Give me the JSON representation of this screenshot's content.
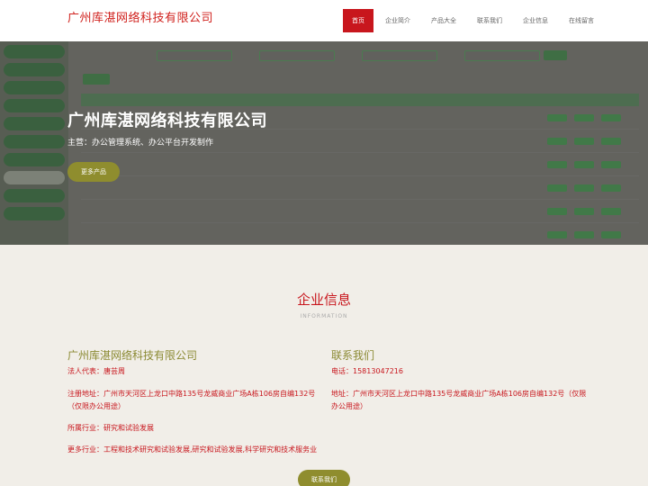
{
  "header": {
    "brand": "广州库湛网络科技有限公司",
    "nav": [
      "首页",
      "企业简介",
      "产品大全",
      "联系我们",
      "企业信息",
      "在线留言"
    ]
  },
  "hero": {
    "title": "广州库湛网络科技有限公司",
    "subtitle": "主营：办公管理系统、办公平台开发制作",
    "button": "更多产品"
  },
  "section": {
    "title": "企业信息",
    "subtitle": "INFORMATION"
  },
  "company": {
    "name": "广州库湛网络科技有限公司",
    "rep_label": "法人代表：",
    "rep_value": "唐芸周",
    "addr_label": "注册地址：",
    "addr_value": "广州市天河区上龙口中路135号龙威商业广场A栋106房自编132号（仅限办公用途）",
    "industry_label": "所属行业：",
    "industry_value": "研究和试验发展",
    "more_label": "更多行业：",
    "more_value": "工程和技术研究和试验发展,研究和试验发展,科学研究和技术服务业"
  },
  "contact": {
    "title": "联系我们",
    "phone_label": "电话：",
    "phone_value": "15813047216",
    "addr_label": "地址：",
    "addr_value": "广州市天河区上龙口中路135号龙威商业广场A栋106房自编132号（仅限办公用途）",
    "button": "联系我们"
  },
  "colors": {
    "brand_red": "#c8161d",
    "olive": "#8f8d2e"
  }
}
